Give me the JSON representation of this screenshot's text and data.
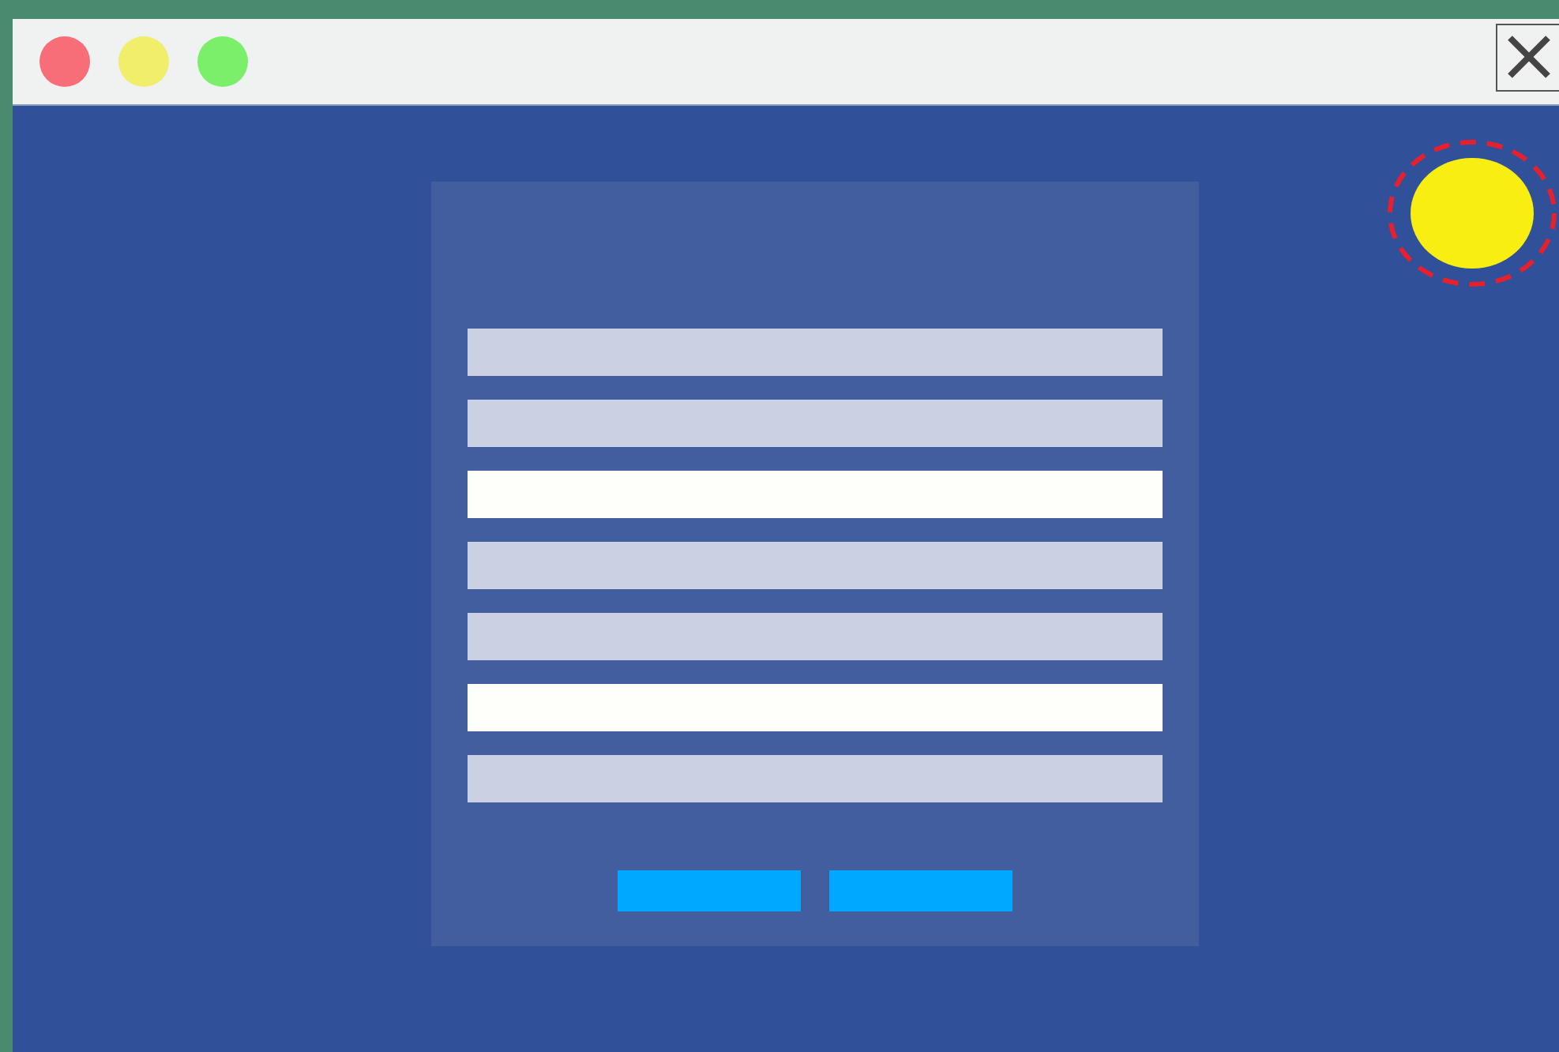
{
  "window": {
    "controls": [
      {
        "color": "#f76d78"
      },
      {
        "color": "#f0ee6a"
      },
      {
        "color": "#7bef6a"
      }
    ]
  },
  "form": {
    "fields": [
      {
        "selected": false
      },
      {
        "selected": false
      },
      {
        "selected": true
      },
      {
        "selected": false
      },
      {
        "selected": false
      },
      {
        "selected": true
      },
      {
        "selected": false
      }
    ],
    "buttons": [
      {
        "kind": "primary"
      },
      {
        "kind": "primary"
      }
    ]
  }
}
